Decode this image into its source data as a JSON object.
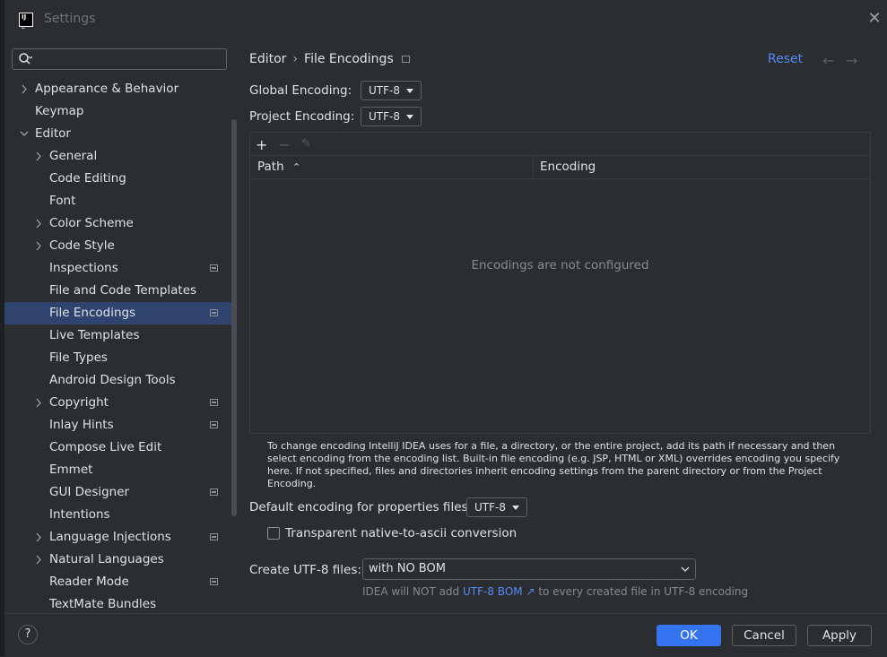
{
  "window": {
    "title": "Settings"
  },
  "search": {
    "placeholder": ""
  },
  "sidebar": {
    "items": [
      {
        "label": "Appearance & Behavior",
        "level": 0,
        "expandable": true,
        "expanded": false,
        "badge": false,
        "selected": false
      },
      {
        "label": "Keymap",
        "level": 0,
        "expandable": false,
        "badge": false,
        "selected": false
      },
      {
        "label": "Editor",
        "level": 0,
        "expandable": true,
        "expanded": true,
        "badge": false,
        "selected": false
      },
      {
        "label": "General",
        "level": 1,
        "expandable": true,
        "expanded": false,
        "badge": false,
        "selected": false
      },
      {
        "label": "Code Editing",
        "level": 1,
        "expandable": false,
        "badge": false,
        "selected": false
      },
      {
        "label": "Font",
        "level": 1,
        "expandable": false,
        "badge": false,
        "selected": false
      },
      {
        "label": "Color Scheme",
        "level": 1,
        "expandable": true,
        "expanded": false,
        "badge": false,
        "selected": false
      },
      {
        "label": "Code Style",
        "level": 1,
        "expandable": true,
        "expanded": false,
        "badge": false,
        "selected": false
      },
      {
        "label": "Inspections",
        "level": 1,
        "expandable": false,
        "badge": true,
        "selected": false
      },
      {
        "label": "File and Code Templates",
        "level": 1,
        "expandable": false,
        "badge": false,
        "selected": false
      },
      {
        "label": "File Encodings",
        "level": 1,
        "expandable": false,
        "badge": true,
        "selected": true
      },
      {
        "label": "Live Templates",
        "level": 1,
        "expandable": false,
        "badge": false,
        "selected": false
      },
      {
        "label": "File Types",
        "level": 1,
        "expandable": false,
        "badge": false,
        "selected": false
      },
      {
        "label": "Android Design Tools",
        "level": 1,
        "expandable": false,
        "badge": false,
        "selected": false
      },
      {
        "label": "Copyright",
        "level": 1,
        "expandable": true,
        "expanded": false,
        "badge": true,
        "selected": false
      },
      {
        "label": "Inlay Hints",
        "level": 1,
        "expandable": false,
        "badge": true,
        "selected": false
      },
      {
        "label": "Compose Live Edit",
        "level": 1,
        "expandable": false,
        "badge": false,
        "selected": false
      },
      {
        "label": "Emmet",
        "level": 1,
        "expandable": false,
        "badge": false,
        "selected": false
      },
      {
        "label": "GUI Designer",
        "level": 1,
        "expandable": false,
        "badge": true,
        "selected": false
      },
      {
        "label": "Intentions",
        "level": 1,
        "expandable": false,
        "badge": false,
        "selected": false
      },
      {
        "label": "Language Injections",
        "level": 1,
        "expandable": true,
        "expanded": false,
        "badge": true,
        "selected": false
      },
      {
        "label": "Natural Languages",
        "level": 1,
        "expandable": true,
        "expanded": false,
        "badge": false,
        "selected": false
      },
      {
        "label": "Reader Mode",
        "level": 1,
        "expandable": false,
        "badge": true,
        "selected": false
      },
      {
        "label": "TextMate Bundles",
        "level": 1,
        "expandable": false,
        "badge": false,
        "selected": false
      }
    ]
  },
  "header": {
    "breadcrumb_parent": "Editor",
    "breadcrumb_sep": "›",
    "breadcrumb_current": "File Encodings",
    "reset_label": "Reset",
    "back_arrow": "←",
    "forward_arrow": "→"
  },
  "encodings": {
    "global_label": "Global Encoding:",
    "global_value": "UTF-8",
    "project_label": "Project Encoding:",
    "project_value": "UTF-8"
  },
  "table": {
    "add_icon": "+",
    "remove_icon": "−",
    "edit_icon": "✎",
    "col_path": "Path",
    "sort_icon": "⌃",
    "col_encoding": "Encoding",
    "empty_text": "Encodings are not configured"
  },
  "info_text": "To change encoding IntelliJ IDEA uses for a file, a directory, or the entire project, add its path if necessary and then select encoding from the encoding list. Built-in file encoding (e.g. JSP, HTML or XML) overrides encoding you specify here. If not specified, files and directories inherit encoding settings from the parent directory or from the Project Encoding.",
  "properties": {
    "label": "Default encoding for properties files:",
    "value": "UTF-8",
    "checkbox_label": "Transparent native-to-ascii conversion",
    "checked": false
  },
  "utf8": {
    "label": "Create UTF-8 files:",
    "value": "with NO BOM",
    "hint_prefix": "IDEA will NOT add",
    "hint_link": "UTF-8 BOM ↗",
    "hint_suffix": "to every created file in UTF-8 encoding"
  },
  "footer": {
    "help_label": "?",
    "ok_label": "OK",
    "cancel_label": "Cancel",
    "apply_label": "Apply"
  },
  "colors": {
    "background": "#2b2d30",
    "selection": "#2e436e",
    "accent": "#3574f0",
    "link": "#548af7",
    "muted_text": "#868a91"
  }
}
